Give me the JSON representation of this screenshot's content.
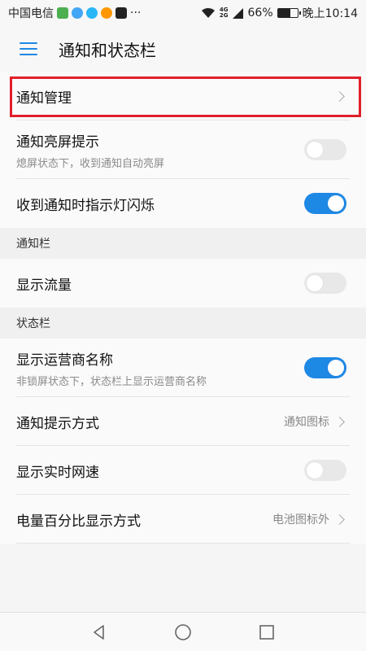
{
  "status_bar": {
    "carrier": "中国电信",
    "more": "···",
    "network_top": "4G",
    "network_bottom": "2G",
    "battery_percent": "66%",
    "battery_level": 0.66,
    "time": "晚上10:14"
  },
  "app_bar": {
    "title": "通知和状态栏",
    "accent_color": "#1e88e5"
  },
  "rows": {
    "notification_management": {
      "title": "通知管理"
    },
    "screen_wake": {
      "title": "通知亮屏提示",
      "subtitle": "熄屏状态下，收到通知自动亮屏",
      "on": false
    },
    "indicator_light": {
      "title": "收到通知时指示灯闪烁",
      "on": true
    }
  },
  "sections": {
    "notification_bar": {
      "header": "通知栏",
      "traffic": {
        "title": "显示流量",
        "on": false
      }
    },
    "status_bar": {
      "header": "状态栏",
      "carrier_name": {
        "title": "显示运营商名称",
        "subtitle": "非锁屏状态下，状态栏上显示运营商名称",
        "on": true
      },
      "notify_style": {
        "title": "通知提示方式",
        "value": "通知图标"
      },
      "net_speed": {
        "title": "显示实时网速",
        "on": false
      },
      "battery_style": {
        "title": "电量百分比显示方式",
        "value": "电池图标外"
      }
    }
  },
  "highlight_color": "#e0202a"
}
